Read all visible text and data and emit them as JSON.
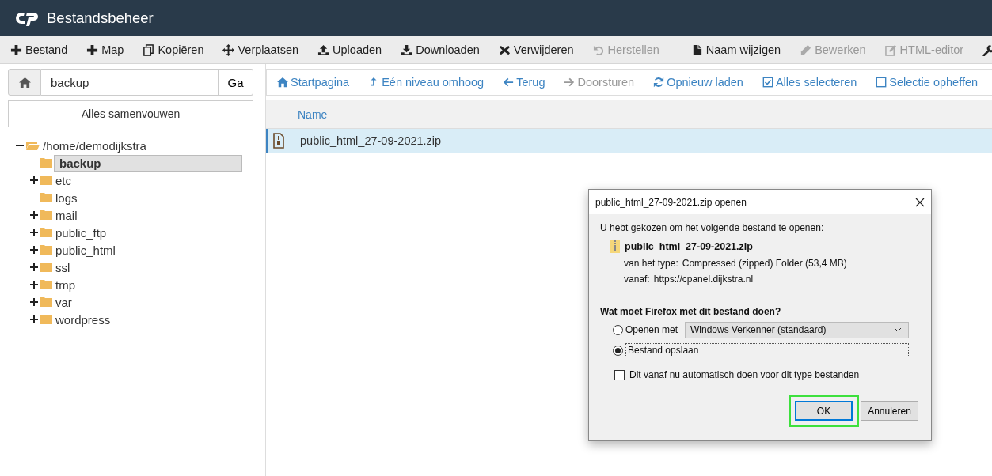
{
  "header": {
    "title": "Bestandsbeheer"
  },
  "toolbar": {
    "groups": [
      [
        {
          "kind": "plus",
          "label": "Bestand",
          "disabled": false
        },
        {
          "kind": "plus",
          "label": "Map",
          "disabled": false
        },
        {
          "kind": "copy",
          "label": "Kopiëren",
          "disabled": false
        },
        {
          "kind": "move",
          "label": "Verplaatsen",
          "disabled": false
        },
        {
          "kind": "upload",
          "label": "Uploaden",
          "disabled": false
        },
        {
          "kind": "download",
          "label": "Downloaden",
          "disabled": false
        },
        {
          "kind": "delete",
          "label": "Verwijderen",
          "disabled": false
        },
        {
          "kind": "undo",
          "label": "Herstellen",
          "disabled": true
        }
      ],
      [
        {
          "kind": "file",
          "label": "Naam wijzigen",
          "disabled": false
        },
        {
          "kind": "pencil",
          "label": "Bewerken",
          "disabled": true
        },
        {
          "kind": "edit",
          "label": "HTML-editor",
          "disabled": true
        },
        {
          "kind": "wrench"
        }
      ]
    ]
  },
  "path_bar": {
    "value": "backup",
    "go_button": "Ga"
  },
  "collapse_button": "Alles samenvouwen",
  "tree": {
    "label": "/home/demodijkstra",
    "expanded": true,
    "children": [
      {
        "label": "backup",
        "selected": true,
        "expandable": false
      },
      {
        "label": "etc",
        "selected": false,
        "expandable": true
      },
      {
        "label": "logs",
        "selected": false,
        "expandable": false
      },
      {
        "label": "mail",
        "selected": false,
        "expandable": true
      },
      {
        "label": "public_ftp",
        "selected": false,
        "expandable": true
      },
      {
        "label": "public_html",
        "selected": false,
        "expandable": true
      },
      {
        "label": "ssl",
        "selected": false,
        "expandable": true
      },
      {
        "label": "tmp",
        "selected": false,
        "expandable": true
      },
      {
        "label": "var",
        "selected": false,
        "expandable": true
      },
      {
        "label": "wordpress",
        "selected": false,
        "expandable": true
      }
    ]
  },
  "nav_bar": [
    {
      "kind": "home",
      "label": "Startpagina",
      "disabled": false
    },
    {
      "kind": "up",
      "label": "Eén niveau omhoog",
      "disabled": false
    },
    {
      "kind": "back",
      "label": "Terug",
      "disabled": false
    },
    {
      "kind": "forward",
      "label": "Doorsturen",
      "disabled": true
    },
    {
      "kind": "reload",
      "label": "Opnieuw laden",
      "disabled": false
    },
    {
      "kind": "check-all",
      "label": "Alles selecteren",
      "disabled": false
    },
    {
      "kind": "uncheck",
      "label": "Selectie opheffen",
      "disabled": false
    }
  ],
  "file_table": {
    "columns": [
      "Name"
    ],
    "rows": [
      {
        "name": "public_html_27-09-2021.zip",
        "selected": true
      }
    ]
  },
  "dialog": {
    "title": "public_html_27-09-2021.zip openen",
    "intro": "U hebt gekozen om het volgende bestand te openen:",
    "file_name": "public_html_27-09-2021.zip",
    "type_label": "van het type:",
    "type_value": "Compressed (zipped) Folder (53,4 MB)",
    "from_label": "vanaf:",
    "from_value": "https://cpanel.dijkstra.nl",
    "question": "Wat moet Firefox met dit bestand doen?",
    "options": [
      {
        "kind": "open-with",
        "label": "Openen met",
        "selected": false,
        "value": "Windows Verkenner (standaard)"
      },
      {
        "kind": "save",
        "label": "Bestand opslaan",
        "selected": true
      }
    ],
    "remember": {
      "label": "Dit vanaf nu automatisch doen voor dit type bestanden",
      "checked": false
    },
    "buttons": [
      {
        "label": "OK",
        "highlighted": true
      },
      {
        "label": "Annuleren",
        "highlighted": false
      }
    ]
  }
}
